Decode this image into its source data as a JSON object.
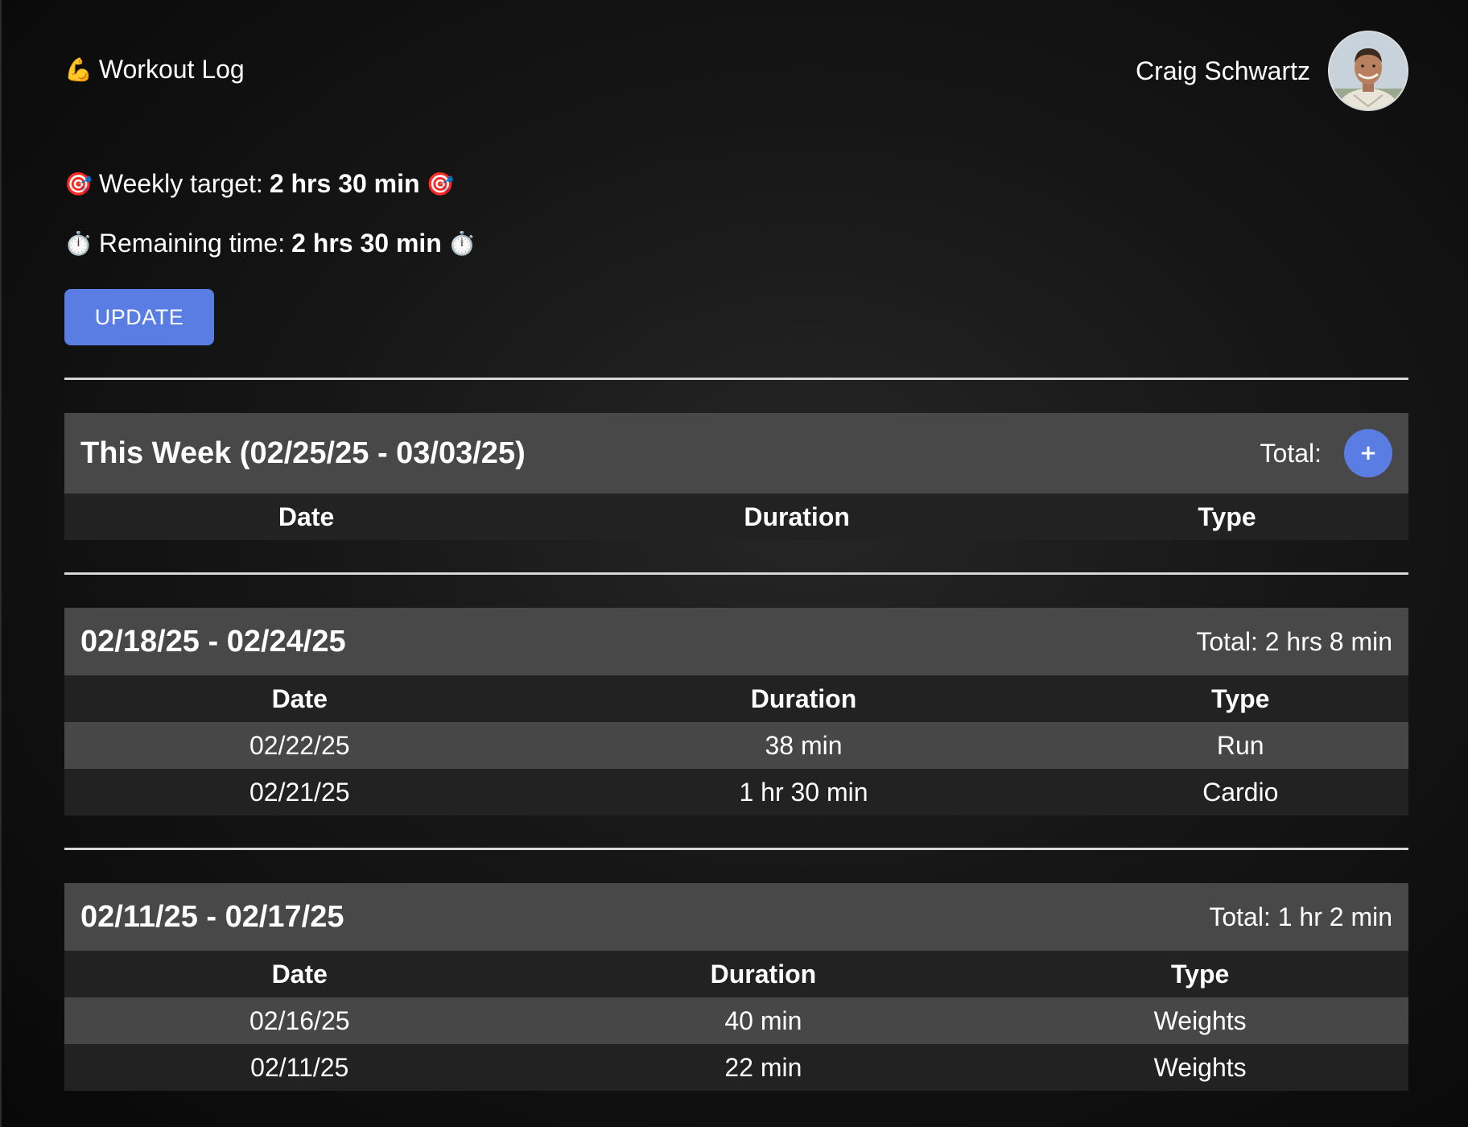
{
  "app": {
    "icon": "💪",
    "title": "Workout Log"
  },
  "user": {
    "name": "Craig Schwartz"
  },
  "stats": {
    "target_icon": "🎯",
    "target_label": "Weekly target:",
    "target_value": "2 hrs 30 min",
    "remaining_icon": "⏱️",
    "remaining_label": "Remaining time:",
    "remaining_value": "2 hrs 30 min"
  },
  "update_label": "UPDATE",
  "columns": [
    "Date",
    "Duration",
    "Type"
  ],
  "weeks": [
    {
      "title": "This Week (02/25/25 - 03/03/25)",
      "total": "Total:",
      "add_label": "+",
      "rows": []
    },
    {
      "title": "02/18/25 - 02/24/25",
      "total": "Total: 2 hrs 8 min",
      "rows": [
        {
          "date": "02/22/25",
          "duration": "38 min",
          "type": "Run"
        },
        {
          "date": "02/21/25",
          "duration": "1 hr 30 min",
          "type": "Cardio"
        }
      ]
    },
    {
      "title": "02/11/25 - 02/17/25",
      "total": "Total: 1 hr 2 min",
      "rows": [
        {
          "date": "02/16/25",
          "duration": "40 min",
          "type": "Weights"
        },
        {
          "date": "02/11/25",
          "duration": "22 min",
          "type": "Weights"
        }
      ]
    }
  ],
  "colors": {
    "accent": "#5a7de3",
    "header_row": "#484848",
    "dark_row": "#222222"
  }
}
